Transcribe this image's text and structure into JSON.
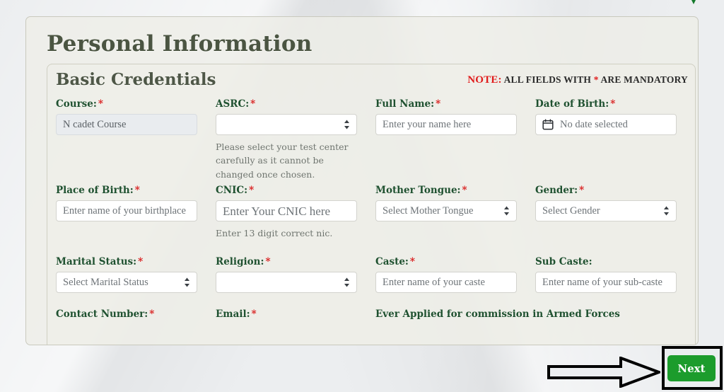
{
  "page": {
    "title": "Personal Information",
    "panel_title": "Basic Credentials",
    "note_label": "NOTE:",
    "note_text": " ALL FIELDS WITH ",
    "note_star": "*",
    "note_text2": " ARE MANDATORY",
    "accent_green": "#1f5130",
    "required_red": "#d91b1b",
    "next_button_green": "#1c9c2c"
  },
  "fields": {
    "course": {
      "label": "Course:",
      "required": "*",
      "value": "N cadet Course"
    },
    "asrc": {
      "label": "ASRC:",
      "required": "*",
      "value": "",
      "hint": "Please select your test center carefully as it cannot be changed once chosen."
    },
    "full_name": {
      "label": "Full Name:",
      "required": "*",
      "placeholder": "Enter your name here"
    },
    "date_of_birth": {
      "label": "Date of Birth:",
      "required": "*",
      "value": "No date selected",
      "icon": "calendar-icon"
    },
    "place_of_birth": {
      "label": "Place of Birth:",
      "required": "*",
      "placeholder": "Enter name of your birthplace"
    },
    "cnic": {
      "label": "CNIC:",
      "required": "*",
      "placeholder": "Enter Your CNIC here",
      "hint": "Enter 13 digit correct nic."
    },
    "mother_tongue": {
      "label": "Mother Tongue:",
      "required": "*",
      "value": "Select Mother Tongue"
    },
    "gender": {
      "label": "Gender:",
      "required": "*",
      "value": "Select Gender"
    },
    "marital_status": {
      "label": "Marital Status:",
      "required": "*",
      "value": "Select Marital Status"
    },
    "religion": {
      "label": "Religion:",
      "required": "*",
      "value": ""
    },
    "caste": {
      "label": "Caste:",
      "required": "*",
      "placeholder": "Enter name of your caste"
    },
    "sub_caste": {
      "label": "Sub Caste:",
      "required": "",
      "placeholder": "Enter name of your sub-caste"
    },
    "contact_number": {
      "label": "Contact Number:",
      "required": "*"
    },
    "email": {
      "label": "Email:",
      "required": "*"
    },
    "ever_applied": {
      "label": "Ever Applied for commission in Armed Forces",
      "required": ""
    }
  },
  "footer": {
    "next_label": "Next"
  }
}
